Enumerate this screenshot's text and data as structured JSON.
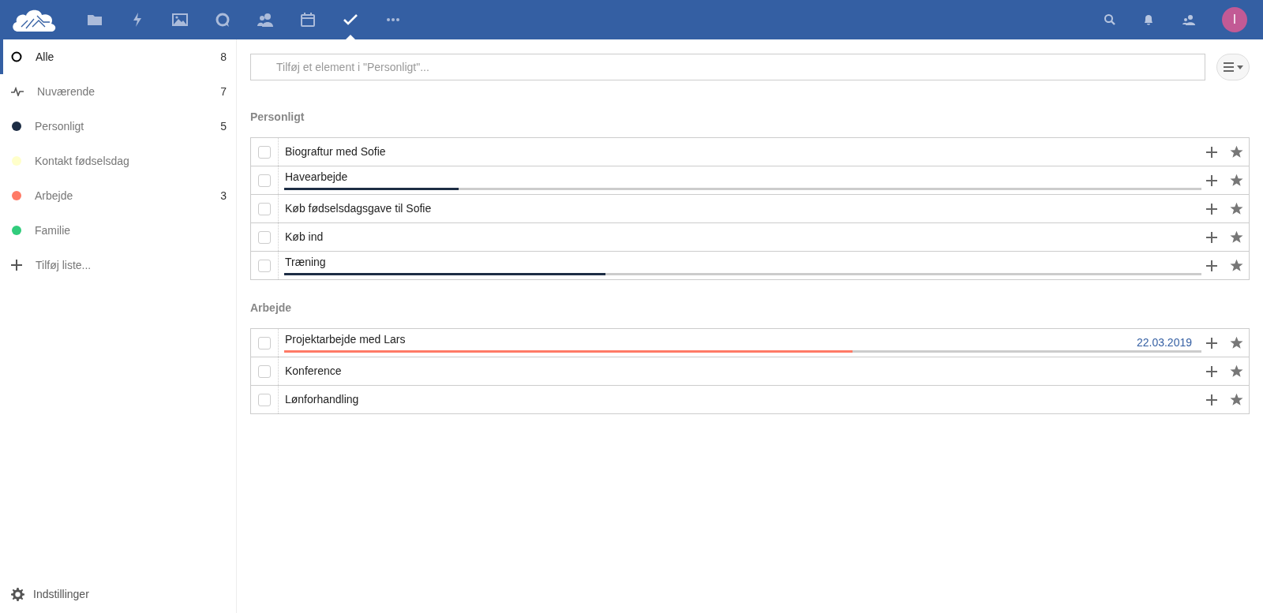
{
  "header": {
    "apps": [
      {
        "kind": "files",
        "selected": false
      },
      {
        "kind": "activity",
        "selected": false
      },
      {
        "kind": "gallery",
        "selected": false
      },
      {
        "kind": "talk",
        "selected": false
      },
      {
        "kind": "contacts",
        "selected": false
      },
      {
        "kind": "calendar",
        "selected": false
      },
      {
        "kind": "tasks",
        "selected": true
      },
      {
        "kind": "more",
        "selected": false
      }
    ],
    "avatar": "I"
  },
  "sidebar": {
    "items": [
      {
        "kind": "all",
        "label": "Alle",
        "count": "8",
        "selected": true
      },
      {
        "kind": "current",
        "label": "Nuværende",
        "count": "7",
        "selected": false
      },
      {
        "kind": "list",
        "label": "Personligt",
        "count": "5",
        "color": "#1d2d44",
        "selected": false
      },
      {
        "kind": "list",
        "label": "Kontakt fødselsdag",
        "color": "#ffffca",
        "selected": false
      },
      {
        "kind": "list",
        "label": "Arbejde",
        "count": "3",
        "color": "#ff7a66",
        "selected": false
      },
      {
        "kind": "list",
        "label": "Familie",
        "color": "#31cc7c",
        "selected": false
      },
      {
        "kind": "add",
        "label": "Tilføj liste...",
        "selected": false
      }
    ],
    "settings": "Indstillinger"
  },
  "add_field": {
    "placeholder": "Tilføj et element i \"Personligt\"..."
  },
  "groups": [
    {
      "title": "Personligt",
      "color": "#1d2d44",
      "tasks": [
        {
          "title": "Biograftur med Sofie",
          "checked": false
        },
        {
          "title": "Havearbejde",
          "checked": false,
          "level": 0.19
        },
        {
          "title": "Køb fødselsdagsgave til Sofie",
          "checked": false
        },
        {
          "title": "Køb ind",
          "checked": false
        },
        {
          "title": "Træning",
          "checked": false,
          "level": 0.35
        }
      ]
    },
    {
      "title": "Arbejde",
      "color": "#ff7a66",
      "tasks": [
        {
          "title": "Projektarbejde med Lars",
          "checked": false,
          "level": 0.62,
          "due": "22.03.2019"
        },
        {
          "title": "Konference",
          "checked": false
        },
        {
          "title": "Lønforhandling",
          "checked": false
        }
      ]
    }
  ]
}
